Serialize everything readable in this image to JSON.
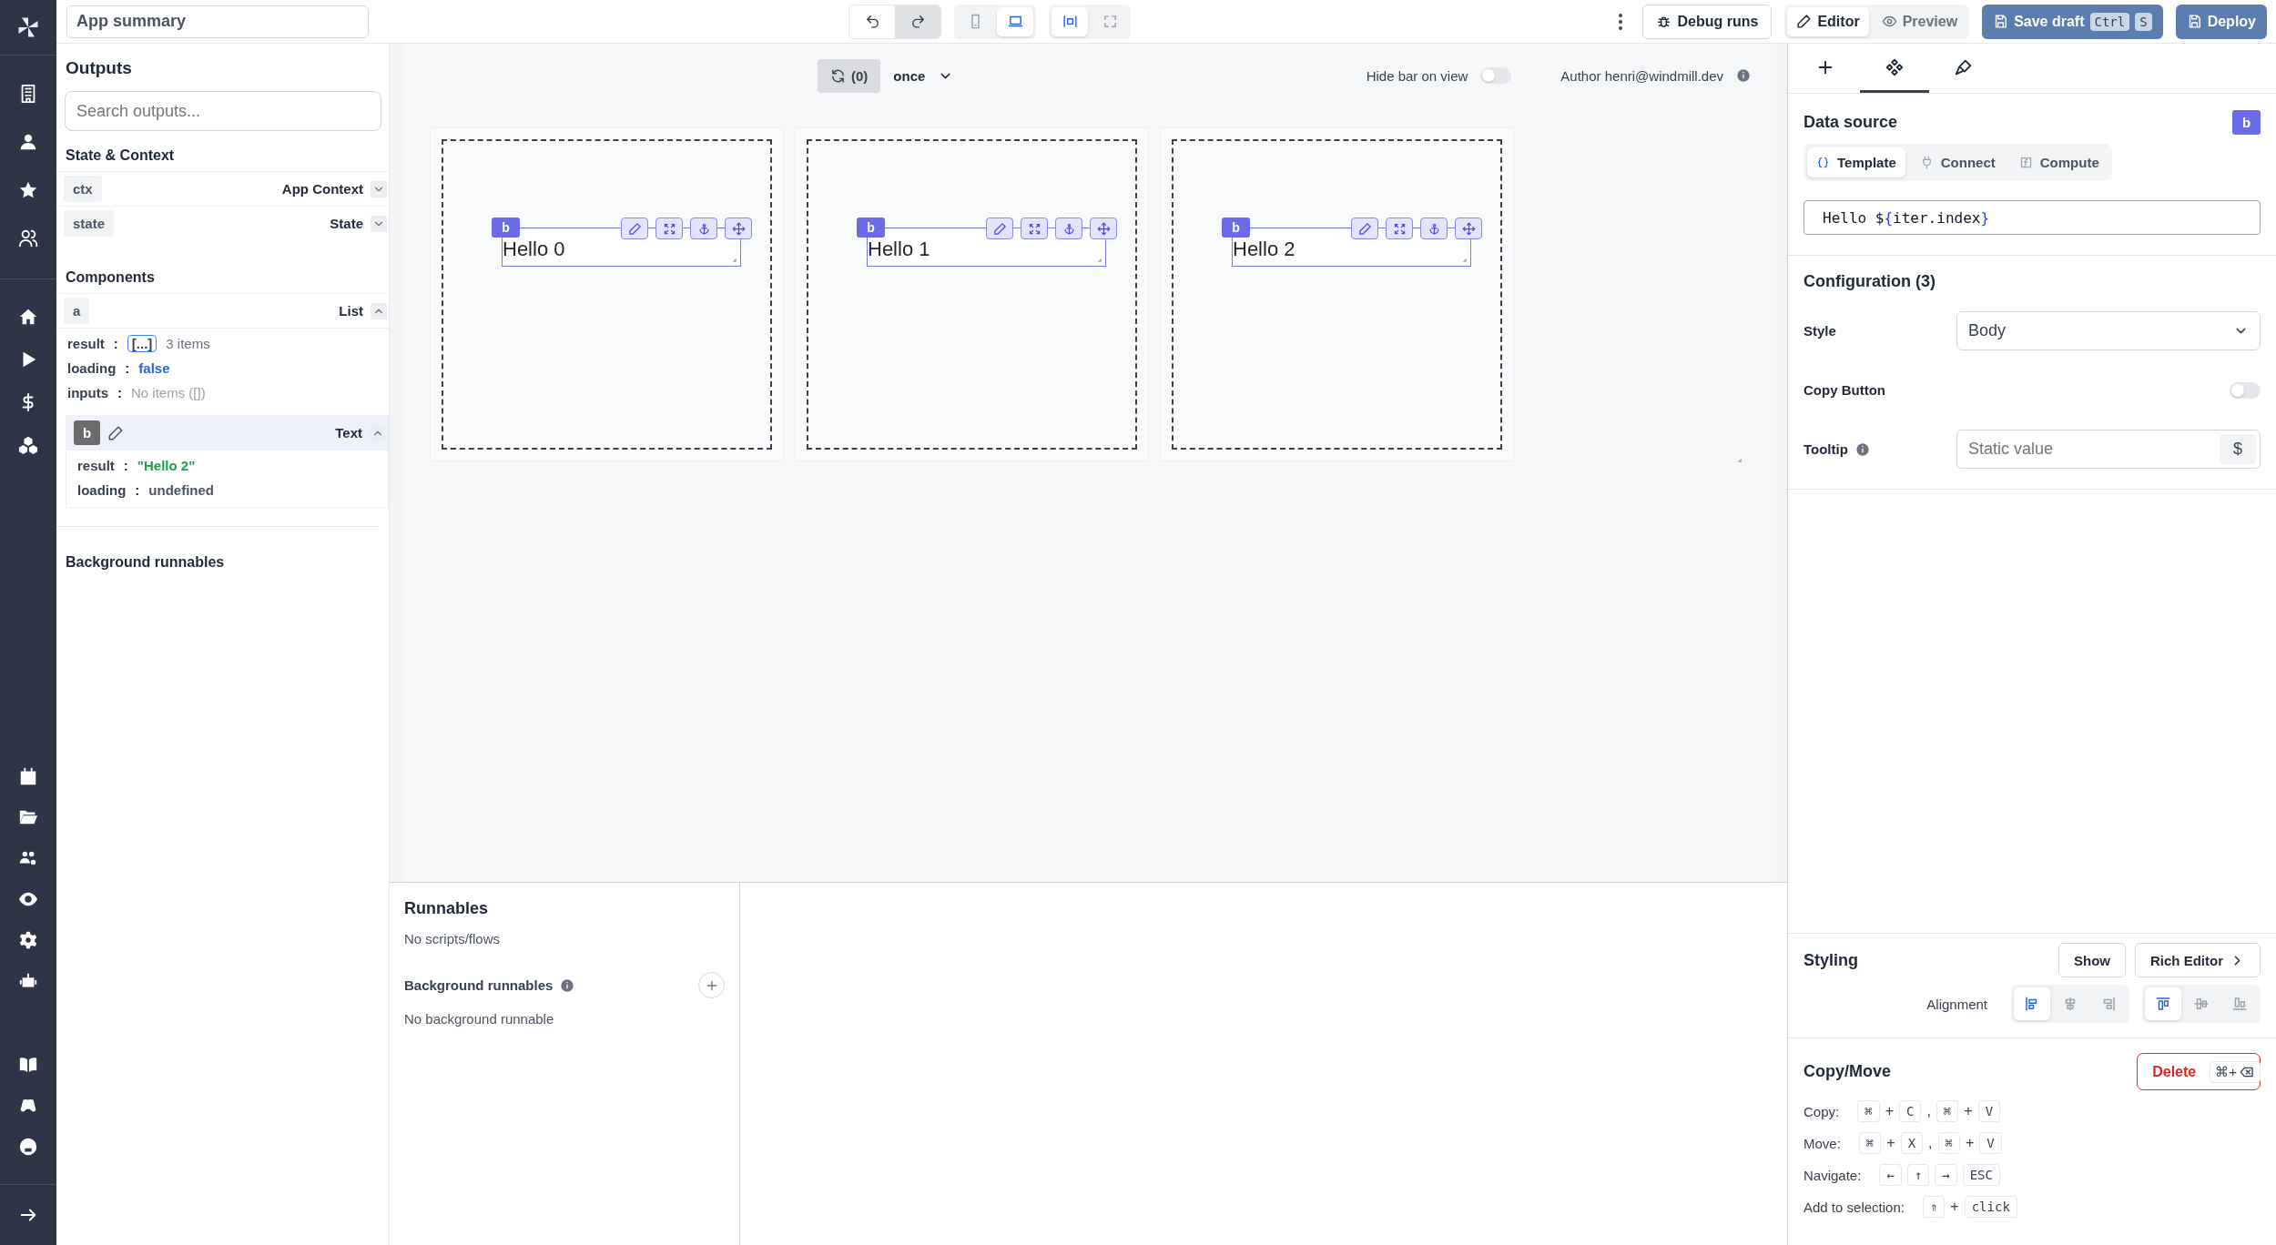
{
  "title_field": {
    "value": "App summary"
  },
  "toolbar": {
    "history": [
      {
        "kind": "undo",
        "disabled": false
      },
      {
        "kind": "redo",
        "disabled": true
      }
    ],
    "devices": [
      {
        "kind": "mobile",
        "selected": false
      },
      {
        "kind": "desktop",
        "selected": true
      }
    ],
    "widths": [
      {
        "kind": "fit",
        "selected": true
      },
      {
        "kind": "fullscreen",
        "selected": false
      }
    ],
    "debug_button": "Debug runs",
    "modes": [
      {
        "kind": "edit",
        "label": "Editor",
        "selected": true
      },
      {
        "kind": "view",
        "label": "Preview",
        "selected": false
      }
    ],
    "save_button": "Save draft",
    "save_keys": [
      "Ctrl",
      "S"
    ],
    "deploy_button": "Deploy"
  },
  "outputs": {
    "title": "Outputs",
    "search_placeholder": "Search outputs...",
    "state_title": "State & Context",
    "state_items": [
      {
        "id": "ctx",
        "label": "App Context",
        "expanded": false
      },
      {
        "id": "state",
        "label": "State",
        "expanded": false
      }
    ],
    "components_title": "Components",
    "components": [
      {
        "id": "a",
        "type": "List",
        "expanded": true,
        "selected": false,
        "fields": [
          {
            "key": "result",
            "sep": ":",
            "kind": "array",
            "badge": "[...]",
            "value": "3 items"
          },
          {
            "key": "loading",
            "sep": ":",
            "kind": "boolean",
            "value": "false"
          },
          {
            "key": "inputs",
            "sep": ":",
            "kind": "empty",
            "value": "No items ([])"
          }
        ],
        "children": [
          {
            "id": "b",
            "type": "Text",
            "expanded": true,
            "selected": true,
            "fields": [
              {
                "key": "result",
                "sep": ":",
                "kind": "string",
                "value": "\"Hello 2\""
              },
              {
                "key": "loading",
                "sep": ":",
                "kind": "undefined",
                "value": "undefined"
              }
            ]
          }
        ]
      }
    ],
    "background_title": "Background runnables"
  },
  "canvas": {
    "refresh_count": "(0)",
    "mode": "once",
    "hide_bar_label": "Hide bar on view",
    "hide_bar_on": false,
    "author": "Author henri@windmill.dev",
    "list_items": [
      {
        "badge": "b",
        "text": "Hello 0"
      },
      {
        "badge": "b",
        "text": "Hello 1"
      },
      {
        "badge": "b",
        "text": "Hello 2"
      }
    ]
  },
  "runnables": {
    "title": "Runnables",
    "empty": "No scripts/flows",
    "background_title": "Background runnables",
    "background_empty": "No background runnable"
  },
  "inspector": {
    "tabs": [
      {
        "kind": "plus",
        "selected": false
      },
      {
        "kind": "components",
        "selected": true
      },
      {
        "kind": "brush",
        "selected": false
      }
    ],
    "data_source": {
      "title": "Data source",
      "badge": "b",
      "modes": [
        {
          "kind": "template",
          "label": "Template",
          "selected": true
        },
        {
          "kind": "connect",
          "label": "Connect",
          "selected": false
        },
        {
          "kind": "compute",
          "label": "Compute",
          "selected": false
        }
      ],
      "code": "Hello ${iter.index}"
    },
    "configuration": {
      "title": "Configuration (3)",
      "rows": [
        {
          "kind": "select",
          "label": "Style",
          "value": "Body"
        },
        {
          "kind": "toggle",
          "label": "Copy Button",
          "on": false
        },
        {
          "kind": "text",
          "label": "Tooltip",
          "info": true,
          "placeholder": "Static value",
          "addon": "$"
        }
      ]
    },
    "styling": {
      "title": "Styling",
      "show_button": "Show",
      "rich_button": "Rich Editor",
      "alignment_label": "Alignment",
      "horizontal": [
        {
          "kind": "left",
          "selected": true
        },
        {
          "kind": "hcenter",
          "selected": false
        },
        {
          "kind": "right",
          "selected": false
        }
      ],
      "vertical": [
        {
          "kind": "top",
          "selected": true
        },
        {
          "kind": "vmiddle",
          "selected": false
        },
        {
          "kind": "bottom",
          "selected": false
        }
      ]
    },
    "copy_move": {
      "title": "Copy/Move",
      "delete_button": "Delete",
      "delete_shortcut": "⌘+",
      "shortcuts": [
        {
          "label": "Copy:",
          "keys": [
            {
              "kind": "key",
              "text": "⌘"
            },
            {
              "kind": "sep",
              "text": "+"
            },
            {
              "kind": "key",
              "text": "C"
            },
            {
              "kind": "sep",
              "text": ","
            },
            {
              "kind": "key",
              "text": "⌘"
            },
            {
              "kind": "sep",
              "text": "+"
            },
            {
              "kind": "key",
              "text": "V"
            }
          ]
        },
        {
          "label": "Move:",
          "keys": [
            {
              "kind": "key",
              "text": "⌘"
            },
            {
              "kind": "sep",
              "text": "+"
            },
            {
              "kind": "key",
              "text": "X"
            },
            {
              "kind": "sep",
              "text": ","
            },
            {
              "kind": "key",
              "text": "⌘"
            },
            {
              "kind": "sep",
              "text": "+"
            },
            {
              "kind": "key",
              "text": "V"
            }
          ]
        },
        {
          "label": "Navigate:",
          "keys": [
            {
              "kind": "key",
              "text": "←"
            },
            {
              "kind": "key",
              "text": "↑"
            },
            {
              "kind": "key",
              "text": "→"
            },
            {
              "kind": "key",
              "text": "ESC"
            }
          ]
        },
        {
          "label": "Add to selection:",
          "keys": [
            {
              "kind": "key",
              "text": "⇑"
            },
            {
              "kind": "sep",
              "text": "+"
            },
            {
              "kind": "key",
              "text": "click"
            }
          ]
        }
      ]
    }
  }
}
